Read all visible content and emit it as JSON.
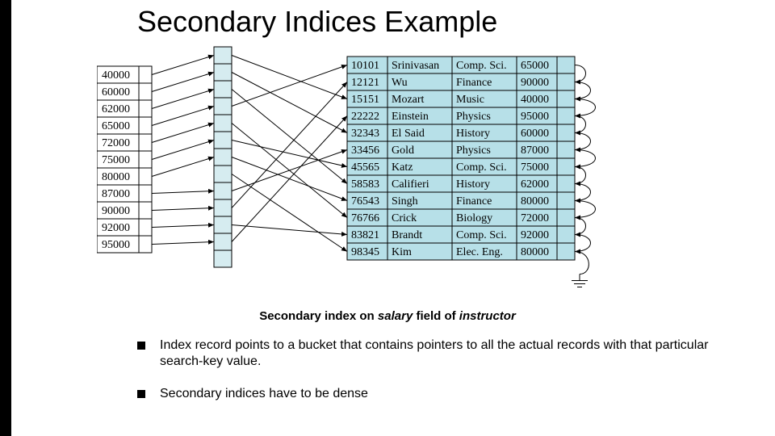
{
  "title": "Secondary Indices Example",
  "caption": {
    "pre": "Secondary index on ",
    "italic1": "salary",
    "mid": " field of ",
    "italic2": "instructor"
  },
  "bullets": [
    "Index record points to a bucket that contains pointers to all the actual records with that particular search-key value.",
    "Secondary indices have to be dense"
  ],
  "chart_data": {
    "type": "table",
    "index_keys": [
      "40000",
      "60000",
      "62000",
      "65000",
      "72000",
      "75000",
      "80000",
      "87000",
      "90000",
      "92000",
      "95000"
    ],
    "records": [
      {
        "id": "10101",
        "name": "Srinivasan",
        "dept": "Comp. Sci.",
        "salary": "65000"
      },
      {
        "id": "12121",
        "name": "Wu",
        "dept": "Finance",
        "salary": "90000"
      },
      {
        "id": "15151",
        "name": "Mozart",
        "dept": "Music",
        "salary": "40000"
      },
      {
        "id": "22222",
        "name": "Einstein",
        "dept": "Physics",
        "salary": "95000"
      },
      {
        "id": "32343",
        "name": "El Said",
        "dept": "History",
        "salary": "60000"
      },
      {
        "id": "33456",
        "name": "Gold",
        "dept": "Physics",
        "salary": "87000"
      },
      {
        "id": "45565",
        "name": "Katz",
        "dept": "Comp. Sci.",
        "salary": "75000"
      },
      {
        "id": "58583",
        "name": "Califieri",
        "dept": "History",
        "salary": "62000"
      },
      {
        "id": "76543",
        "name": "Singh",
        "dept": "Finance",
        "salary": "80000"
      },
      {
        "id": "76766",
        "name": "Crick",
        "dept": "Biology",
        "salary": "72000"
      },
      {
        "id": "83821",
        "name": "Brandt",
        "dept": "Comp. Sci.",
        "salary": "92000"
      },
      {
        "id": "98345",
        "name": "Kim",
        "dept": "Elec. Eng.",
        "salary": "80000"
      }
    ],
    "bucket_map": {
      "40000": [
        2
      ],
      "60000": [
        4
      ],
      "62000": [
        7
      ],
      "65000": [
        0
      ],
      "72000": [
        9
      ],
      "75000": [
        6
      ],
      "80000": [
        8,
        11
      ],
      "87000": [
        5
      ],
      "90000": [
        1
      ],
      "92000": [
        10
      ],
      "95000": [
        3
      ]
    },
    "column_widths": {
      "id": 50,
      "name": 80,
      "dept": 80,
      "salary": 50
    }
  }
}
